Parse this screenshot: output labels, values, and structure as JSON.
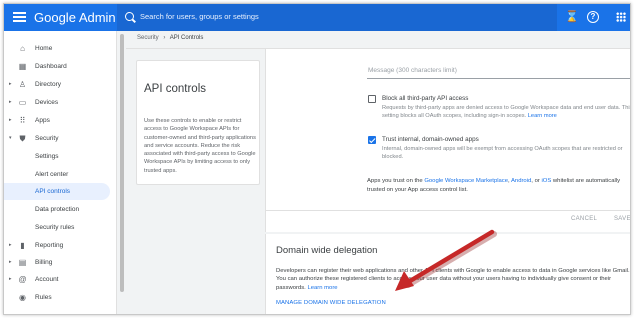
{
  "topbar": {
    "brand": "Google Admin",
    "search_placeholder": "Search for users, groups or settings",
    "hourglass_glyph": "⌛",
    "help_glyph": "?"
  },
  "sidebar": {
    "items": [
      {
        "label": "Home",
        "icon": "home-icon",
        "glyph": "⌂"
      },
      {
        "label": "Dashboard",
        "icon": "dashboard-icon",
        "glyph": "▦"
      },
      {
        "label": "Directory",
        "icon": "person-icon",
        "glyph": "♙",
        "caret": "▸"
      },
      {
        "label": "Devices",
        "icon": "devices-icon",
        "glyph": "▭",
        "caret": "▸"
      },
      {
        "label": "Apps",
        "icon": "apps-grid-icon",
        "glyph": "⠿",
        "caret": "▸"
      },
      {
        "label": "Security",
        "icon": "shield-icon",
        "glyph": "⛊",
        "caret": "▾"
      },
      {
        "label": "Settings"
      },
      {
        "label": "Alert center"
      },
      {
        "label": "API controls",
        "active": true
      },
      {
        "label": "Data protection"
      },
      {
        "label": "Security rules"
      },
      {
        "label": "Reporting",
        "icon": "bar-chart-icon",
        "glyph": "▮",
        "caret": "▸"
      },
      {
        "label": "Billing",
        "icon": "billing-icon",
        "glyph": "▤",
        "caret": "▸"
      },
      {
        "label": "Account",
        "icon": "at-icon",
        "glyph": "@",
        "caret": "▸"
      },
      {
        "label": "Rules",
        "icon": "rules-icon",
        "glyph": "◉"
      }
    ]
  },
  "breadcrumb": {
    "parent": "Security",
    "separator": "›",
    "current": "API Controls"
  },
  "info_card": {
    "title": "API controls",
    "text": "Use these controls to enable or restrict access to Google Workspace APIs for customer-owned and third-party applications and service accounts. Reduce the risk associated with third-party access to Google Workspace APIs by limiting access to only trusted apps."
  },
  "settings": {
    "message_placeholder": "Message (300 characters limit)",
    "block_option": {
      "label": "Block all third-party API access",
      "checked": false,
      "description": "Requests by third-party apps are denied access to Google Workspace data and end user data. This setting blocks all OAuth scopes, including sign-in scopes.",
      "link": "Learn more"
    },
    "trust_option": {
      "label": "Trust internal, domain-owned apps",
      "checked": true,
      "description": "Internal, domain-owned apps will be exempt from accessing OAuth scopes that are restricted or blocked."
    },
    "trust_text": {
      "pre": "Apps you trust on the ",
      "link1": "Google Workspace Marketplace",
      "sep1": ", ",
      "link2": "Android",
      "sep2": ", or ",
      "link3": "iOS",
      "post": " whitelist are automatically trusted on your App access control list."
    },
    "cancel_label": "CANCEL",
    "save_label": "SAVE"
  },
  "delegation": {
    "title": "Domain wide delegation",
    "text": "Developers can register their web applications and other API clients with Google to enable access to data in Google services like Gmail. You can authorize these registered clients to access your user data without your users having to individually give consent or their passwords.",
    "learn_more": "Learn more",
    "manage_link": "MANAGE DOMAIN WIDE DELEGATION"
  },
  "colors": {
    "accent": "#1a73e8",
    "annotation_arrow": "#c62828"
  }
}
